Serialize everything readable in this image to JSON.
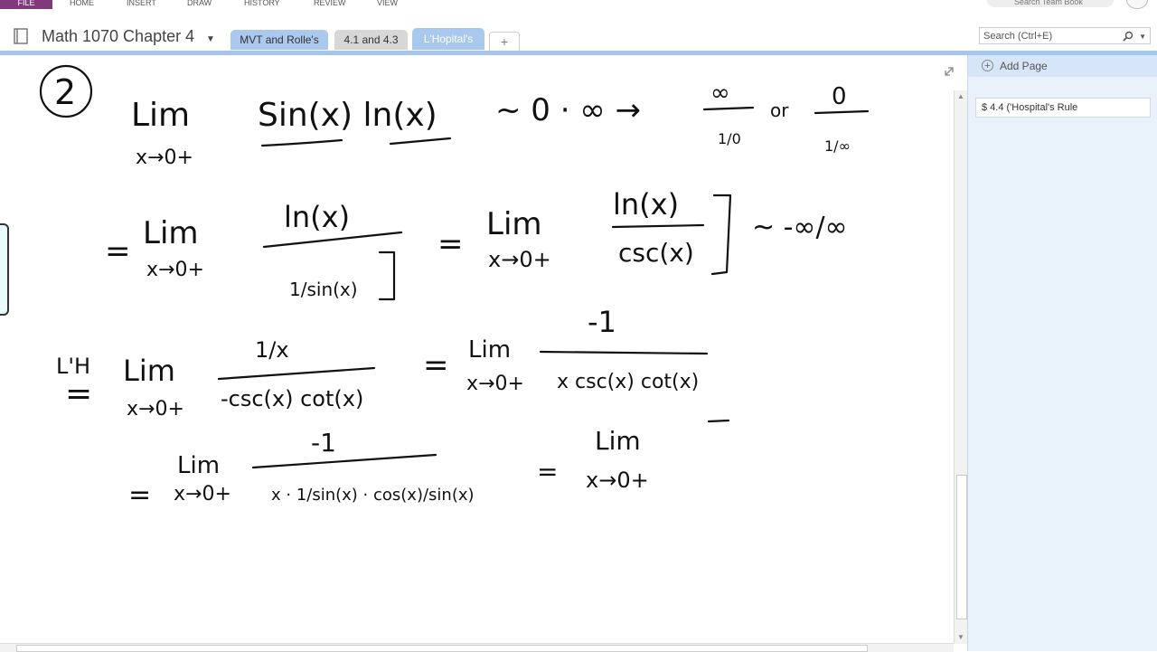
{
  "ribbon": {
    "file_label": "FILE",
    "menus": [
      "HOME",
      "INSERT",
      "DRAW",
      "HISTORY",
      "REVIEW",
      "VIEW"
    ],
    "search_all": "Search Team Book"
  },
  "notebook": {
    "title": "Math 1070 Chapter 4"
  },
  "sections": [
    {
      "label": "MVT and Rolle's"
    },
    {
      "label": "4.1 and 4.3"
    },
    {
      "label": "L'Hopital's"
    }
  ],
  "add_section_label": "+",
  "search": {
    "placeholder": "Search (Ctrl+E)"
  },
  "pages_pane": {
    "add_page_label": "Add Page",
    "pages": [
      {
        "title": "$ 4.4 ('Hospital's Rule"
      }
    ]
  },
  "ink_text": {
    "problem_number": "2",
    "line1_lim": "Lim",
    "line1_sub": "x→0+",
    "line1_expr": "Sin(x) ln(x)",
    "line1_form": "~ 0 · ∞ →",
    "line1_frac1_num": "∞",
    "line1_frac1_den": "1/0",
    "line1_or": "or",
    "line1_frac2_num": "0",
    "line1_frac2_den": "1/∞",
    "line2_eq": "=",
    "line2_lim": "Lim",
    "line2_sub": "x→0+",
    "line2_num": "ln(x)",
    "line2_den": "1/sin(x)",
    "line2_eq2": "=",
    "line2_lim2": "Lim",
    "line2_sub2": "x→0+",
    "line2_num2": "ln(x)",
    "line2_den2": "csc(x)",
    "line2_form": "~ -∞/∞",
    "line3_lh": "L'H",
    "line3_eq": "=",
    "line3_lim": "Lim",
    "line3_sub": "x→0+",
    "line3_num": "1/x",
    "line3_den": "-csc(x) cot(x)",
    "line3_eq2": "=",
    "line3_lim2": "Lim",
    "line3_sub2": "x→0+",
    "line3_num2": "-1",
    "line3_den2": "x csc(x) cot(x)",
    "line4_eq": "=",
    "line4_lim": "Lim",
    "line4_sub": "x→0+",
    "line4_num": "-1",
    "line4_den": "x · 1/sin(x) · cos(x)/sin(x)",
    "line4_eq2": "=",
    "line4_lim2": "Lim",
    "line4_sub2": "x→0+"
  },
  "colors": {
    "file_tab": "#80397b",
    "section_blue": "#a6c5ec",
    "pane_bg": "#e9f1fb"
  }
}
